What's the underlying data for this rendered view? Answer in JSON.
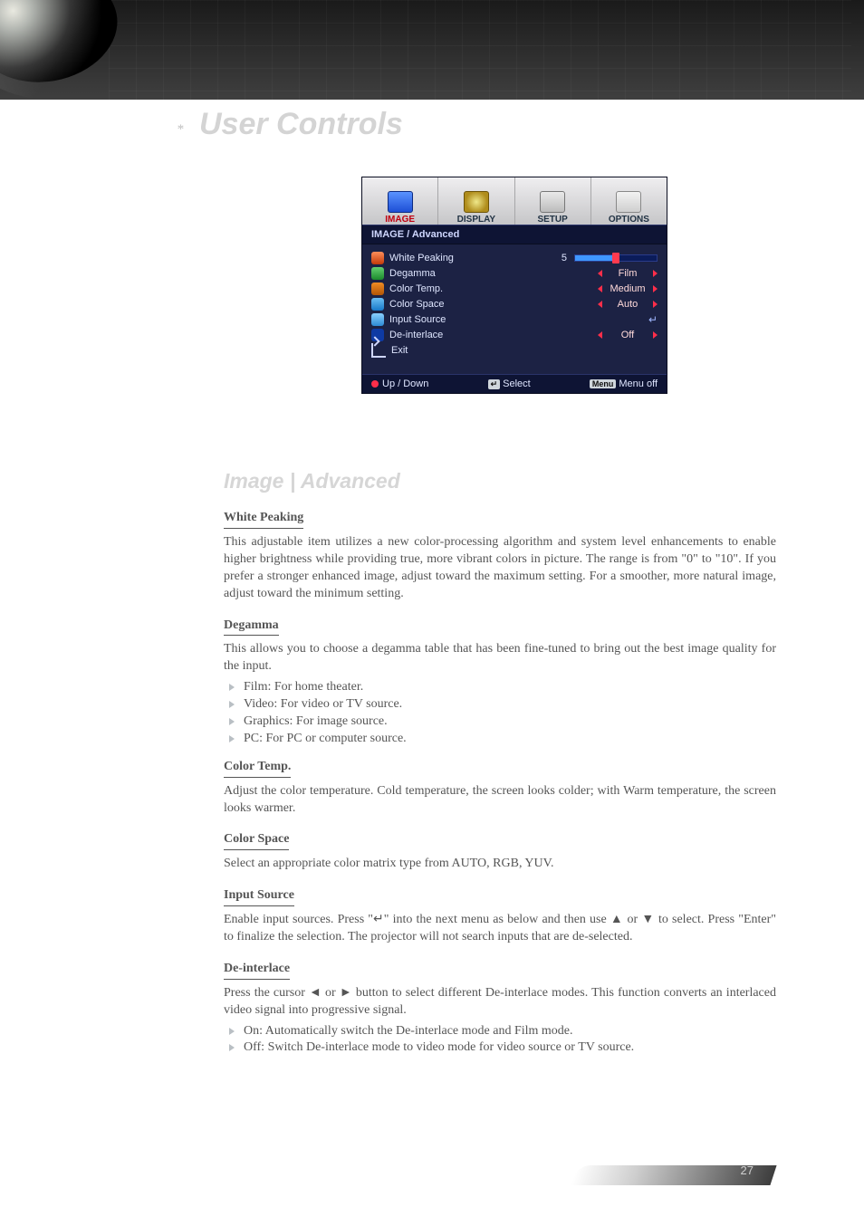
{
  "header": {
    "section_title": "User Controls",
    "section_marker": "*"
  },
  "osd": {
    "tabs": {
      "image": "IMAGE",
      "display": "DISPLAY",
      "setup": "SETUP",
      "options": "OPTIONS"
    },
    "breadcrumb": "IMAGE / Advanced",
    "rows": {
      "white_peaking": "White Peaking",
      "degamma": "Degamma",
      "color_temp": "Color Temp.",
      "color_space": "Color Space",
      "input_source": "Input Source",
      "deinterlace": "De-interlace",
      "exit": "Exit"
    },
    "values": {
      "white_peaking_num": "5",
      "degamma": "Film",
      "color_temp": "Medium",
      "color_space": "Auto",
      "input_source": "↵",
      "deinterlace": "Off"
    },
    "footer": {
      "updown": "Up / Down",
      "select_key": "↵",
      "select": "Select",
      "menu_key": "Menu",
      "menuoff": "Menu off"
    }
  },
  "content": {
    "subheading": "Image | Advanced",
    "white_peaking": {
      "title": "White Peaking",
      "p1": "This adjustable item utilizes a new color-processing algorithm and system level enhancements to enable higher brightness while providing true, more vibrant colors in picture. The range is from \"0\" to \"10\". If you prefer a stronger enhanced image, adjust toward the maximum setting. For a smoother, more natural image, adjust toward the minimum setting."
    },
    "degamma": {
      "title": "Degamma",
      "lead": "This allows you to choose a degamma table that has been fine-tuned to bring out the best image quality for the input.",
      "b1": "Film: For home theater.",
      "b2": "Video: For video or TV source.",
      "b3": "Graphics: For image source.",
      "b4": "PC: For PC or computer source."
    },
    "color_temp": {
      "title": "Color Temp.",
      "p1": "Adjust the color temperature. Cold temperature, the screen looks colder; with Warm temperature, the screen looks warmer."
    },
    "color_space": {
      "title": "Color Space",
      "p1": "Select an appropriate color matrix type from AUTO, RGB, YUV."
    },
    "input_source": {
      "title": "Input Source",
      "p1": "Enable input sources. Press \"↵\" into the next menu as below and then use ▲ or ▼ to select. Press \"Enter\" to finalize the selection. The projector will not search inputs that are de-selected."
    },
    "deinterlace": {
      "title": "De-interlace",
      "lead": "Press the cursor ◄ or ► button to select different De-interlace modes. This function converts an interlaced video signal into progressive signal.",
      "b1": "On: Automatically switch the De-interlace mode and Film mode.",
      "b2": "Off: Switch De-interlace mode to video mode for video source or TV source."
    }
  },
  "page_number": "27"
}
